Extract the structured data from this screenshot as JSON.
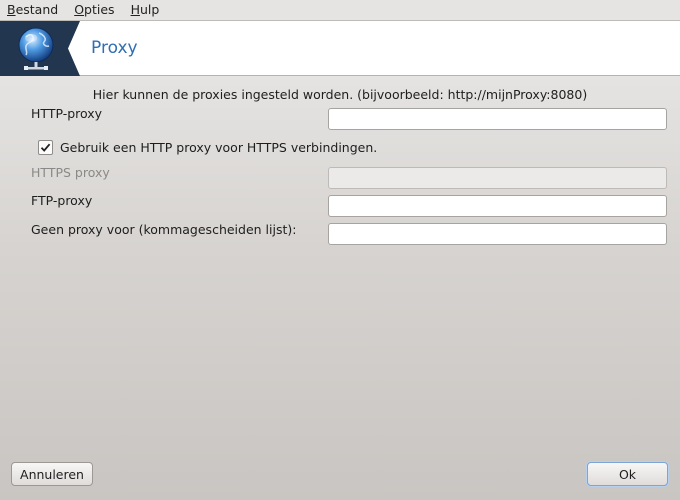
{
  "menubar": {
    "items": [
      {
        "accel": "B",
        "rest": "estand"
      },
      {
        "accel": "O",
        "rest": "pties"
      },
      {
        "accel": "H",
        "rest": "ulp"
      }
    ]
  },
  "header": {
    "title": "Proxy",
    "icon": "globe-network-icon"
  },
  "form": {
    "info": "Hier kunnen de proxies ingesteld worden. (bijvoorbeeld: http://mijnProxy:8080)",
    "http_label": "HTTP-proxy",
    "http_value": "",
    "use_http_for_https_label": "Gebruik een HTTP proxy voor HTTPS verbindingen.",
    "use_http_for_https_checked": true,
    "https_label": "HTTPS proxy",
    "https_value": "",
    "https_enabled": false,
    "ftp_label": "FTP-proxy",
    "ftp_value": "",
    "no_proxy_label": "Geen proxy voor (kommagescheiden lijst):",
    "no_proxy_value": ""
  },
  "buttons": {
    "cancel": "Annuleren",
    "ok": "Ok"
  },
  "colors": {
    "header_title": "#2f6eb4",
    "logo_background": "#22374f"
  }
}
